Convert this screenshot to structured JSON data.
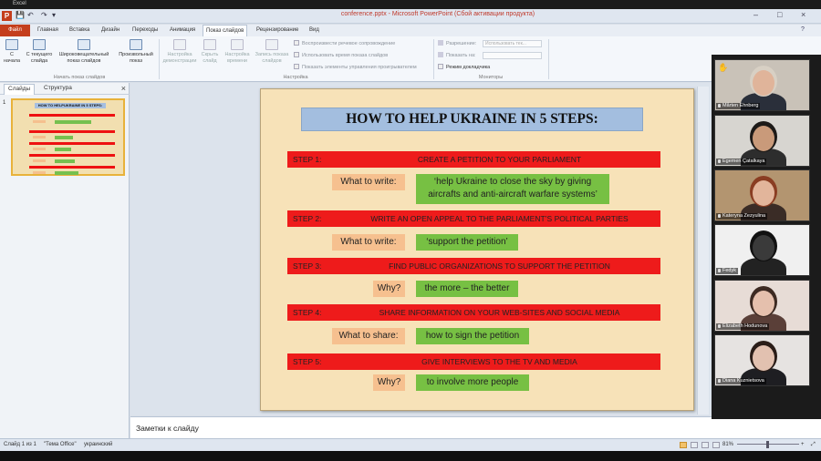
{
  "topbar": {
    "label": "Excel"
  },
  "title_bar": {
    "title": "conference.pptx - Microsoft PowerPoint (Сбой активации продукта)",
    "icon_letter": "P",
    "minimize": "–",
    "restore": "□",
    "close": "×"
  },
  "tabs": [
    {
      "label": "Файл",
      "active": false
    },
    {
      "label": "Главная",
      "active": false
    },
    {
      "label": "Вставка",
      "active": false
    },
    {
      "label": "Дизайн",
      "active": false
    },
    {
      "label": "Переходы",
      "active": false
    },
    {
      "label": "Анимация",
      "active": false
    },
    {
      "label": "Показ слайдов",
      "active": true
    },
    {
      "label": "Рецензирование",
      "active": false
    },
    {
      "label": "Вид",
      "active": false
    }
  ],
  "ribbon": {
    "buttons": {
      "from_start": "С начала",
      "from_current": "С текущего слайда",
      "broadcast": "Широковещательный показ слайдов",
      "custom": "Произвольный показ",
      "setup": "Настройка демонстрации",
      "hide": "Скрыть слайд",
      "rehearse": "Настройка времени",
      "record": "Запись показа слайдов"
    },
    "checkboxes": {
      "narrations": "Воспроизвести речевое сопровождение",
      "timings": "Использовать время показа слайдов",
      "controls": "Показать элементы управления проигрывателем",
      "presenter_view": "Режим докладчика"
    },
    "monitors": {
      "resolution_label": "Разрешение:",
      "resolution_value": "Использовать тек...",
      "show_on_label": "Показать на:",
      "show_on_value": ""
    },
    "groups": {
      "start": "Начать показ слайдов",
      "setup": "Настройка",
      "monitors": "Мониторы"
    }
  },
  "left_pane": {
    "tab_slides": "Слайды",
    "tab_outline": "Структура",
    "close": "×",
    "slide_number": "1",
    "thumb_title": "HOW TO HELPUKRAINE IN 5 STEPS:"
  },
  "slide": {
    "title": "HOW TO HELP UKRAINE IN 5 STEPS:",
    "steps": [
      {
        "num": "STEP 1:",
        "text": "CREATE A PETITION TO YOUR PARLIAMENT",
        "label": "What to write:",
        "answer_line1": "‘help Ukraine to close the sky by giving",
        "answer_line2": "aircrafts and anti-aircraft warfare systems’"
      },
      {
        "num": "STEP 2:",
        "text": "WRITE AN OPEN APPEAL TO THE PARLIAMENT’S POLITICAL PARTIES",
        "label": "What to write:",
        "answer": "‘support the petition’"
      },
      {
        "num": "STEP 3:",
        "text": "FIND PUBLIC ORGANIZATIONS TO SUPPORT THE PETITION",
        "label": "Why?",
        "answer": "the more – the better"
      },
      {
        "num": "STEP 4:",
        "text": "SHARE INFORMATION ON YOUR WEB-SITES AND SOCIAL MEDIA",
        "label": "What to share:",
        "answer": "how to sign the petition"
      },
      {
        "num": "STEP 5:",
        "text": "GIVE INTERVIEWS TO THE TV AND MEDIA",
        "label": "Why?",
        "answer": "to involve more people"
      }
    ],
    "colors": {
      "background": "#f7e2b8",
      "title_box": "#a3bedf",
      "step_bar": "#ee1b1b",
      "label_box": "#f6c08f",
      "answer_box": "#77c043"
    }
  },
  "notes": {
    "placeholder": "Заметки к слайду"
  },
  "status_bar": {
    "slide_info": "Слайд 1 из 1",
    "theme": "\"Тема Office\"",
    "language": "украинский",
    "zoom": "81%"
  },
  "participants": [
    {
      "name": "Mårten Ehnberg",
      "bg": "#c9c2b8",
      "skin": "#e0b49a",
      "shirt": "#2a2f3a",
      "hair": "#d8d0c4"
    },
    {
      "name": "Egemen Çatalkaya",
      "bg": "#d7d5d0",
      "skin": "#c99a7a",
      "shirt": "#2d2d2d",
      "hair": "#1d1a18"
    },
    {
      "name": "Kateryna Zezyulina",
      "bg": "#b39570",
      "skin": "#e2b59b",
      "shirt": "#3a2c26",
      "hair": "#8a3d22"
    },
    {
      "name": "Fedyk",
      "bg": "#f0f0f0",
      "skin": "#3a3a3a",
      "shirt": "#222",
      "hair": "#111"
    },
    {
      "name": "Elizabeth Hodunova",
      "bg": "#e7dcd6",
      "skin": "#e5c0ad",
      "shirt": "#5a3f38",
      "hair": "#3d2a22"
    },
    {
      "name": "Diana Kuznietsova",
      "bg": "#e6e3e1",
      "skin": "#e2c1b0",
      "shirt": "#1e1e22",
      "hair": "#2a1d18"
    }
  ]
}
